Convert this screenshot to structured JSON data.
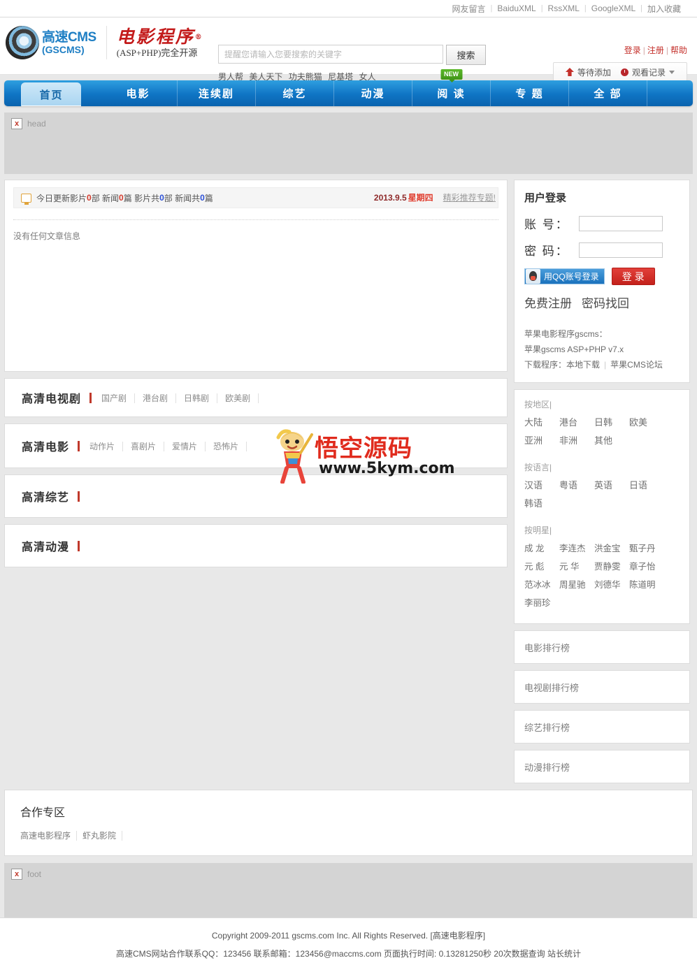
{
  "topbar": {
    "links": [
      "网友留言",
      "BaiduXML",
      "RssXML",
      "GoogleXML",
      "加入收藏"
    ]
  },
  "header": {
    "logo": {
      "line1": "高速CMS",
      "line2": "(GSCMS)"
    },
    "brand": {
      "main": "电影程序",
      "reg": "®",
      "sub": "(ASP+PHP)完全开源"
    },
    "search": {
      "placeholder": "提醒您请输入您要搜索的关键字",
      "value": "",
      "button": "搜索",
      "hotwords": [
        "男人帮",
        "美人天下",
        "功夫熊猫",
        "尼基塔",
        "女人"
      ]
    },
    "account": {
      "links": [
        "登录",
        "注册",
        "帮助"
      ],
      "pending": "等待添加",
      "history": "观看记录"
    }
  },
  "nav": {
    "items": [
      {
        "label": "首页",
        "active": true,
        "badge": ""
      },
      {
        "label": "电影",
        "active": false,
        "badge": ""
      },
      {
        "label": "连续剧",
        "active": false,
        "badge": ""
      },
      {
        "label": "综艺",
        "active": false,
        "badge": ""
      },
      {
        "label": "动漫",
        "active": false,
        "badge": ""
      },
      {
        "label": "阅 读",
        "active": false,
        "badge": "NEW"
      },
      {
        "label": "专 题",
        "active": false,
        "badge": ""
      },
      {
        "label": "全 部",
        "active": false,
        "badge": ""
      }
    ]
  },
  "placeholders": {
    "head_label": "head",
    "foot_label": "foot",
    "broken_glyph": "x"
  },
  "news": {
    "stats": {
      "p1": "今日更新影片",
      "n1": "0",
      "p2": "部 新闻",
      "n2": "0",
      "p3": "篇 影片共 ",
      "n3": "0",
      "p4": "部 新闻共",
      "n4": "0",
      "p5": "篇"
    },
    "date": "2013.9.5",
    "weekday": "星期四",
    "topic": "精彩推荐专题!",
    "empty": "没有任何文章信息"
  },
  "login": {
    "title": "用户登录",
    "account_label": "账 号：",
    "password_label": "密 码：",
    "account_value": "",
    "password_value": "",
    "qq_button": "用QQ账号登录",
    "submit_button": "登 录",
    "register": "免费注册",
    "findpass": "密码找回",
    "info": {
      "line1": "苹果电影程序gscms：",
      "line2": "苹果gscms ASP+PHP v7.x",
      "line3_prefix": "下载程序：",
      "line3_link1": "本地下载",
      "line3_link2": "苹果CMS论坛"
    }
  },
  "sections": [
    {
      "title": "高清电视剧",
      "links": [
        "国产剧",
        "港台剧",
        "日韩剧",
        "欧美剧"
      ]
    },
    {
      "title": "高清电影",
      "links": [
        "动作片",
        "喜剧片",
        "爱情片",
        "恐怖片"
      ]
    },
    {
      "title": "高清综艺",
      "links": []
    },
    {
      "title": "高清动漫",
      "links": []
    }
  ],
  "filters": [
    {
      "head": "按地区|",
      "items": [
        "大陆",
        "港台",
        "日韩",
        "欧美",
        "亚洲",
        "非洲",
        "其他"
      ]
    },
    {
      "head": "按语言|",
      "items": [
        "汉语",
        "粤语",
        "英语",
        "日语",
        "韩语"
      ]
    },
    {
      "head": "按明星|",
      "items": [
        "成 龙",
        "李连杰",
        "洪金宝",
        "甄子丹",
        "元 彪",
        "元 华",
        "贾静雯",
        "章子怡",
        "范冰冰",
        "周星驰",
        "刘德华",
        "陈道明",
        "李丽珍"
      ]
    }
  ],
  "ranks": [
    "电影排行榜",
    "电视剧排行榜",
    "综艺排行榜",
    "动漫排行榜"
  ],
  "partner": {
    "title": "合作专区",
    "links": [
      "高速电影程序",
      "虾丸影院"
    ]
  },
  "watermark": {
    "text": "悟空源码",
    "url": "www.5kym.com"
  },
  "footer": {
    "line1_prefix": "Copyright 2009-2011 gscms.com Inc. All Rights Reserved. [",
    "line1_link": "高速电影程序",
    "line1_suffix": "]",
    "line2_a": "高速CMS网站合作联系QQ：123456 联系邮箱：123456@maccms.com 页面执行时间: 0.13281250秒  20次数据查询 ",
    "line2_link": "站长统计"
  },
  "colors": {
    "accent_blue": "#0f74c4",
    "accent_red": "#c4302b",
    "badge_green": "#4aa61f"
  }
}
